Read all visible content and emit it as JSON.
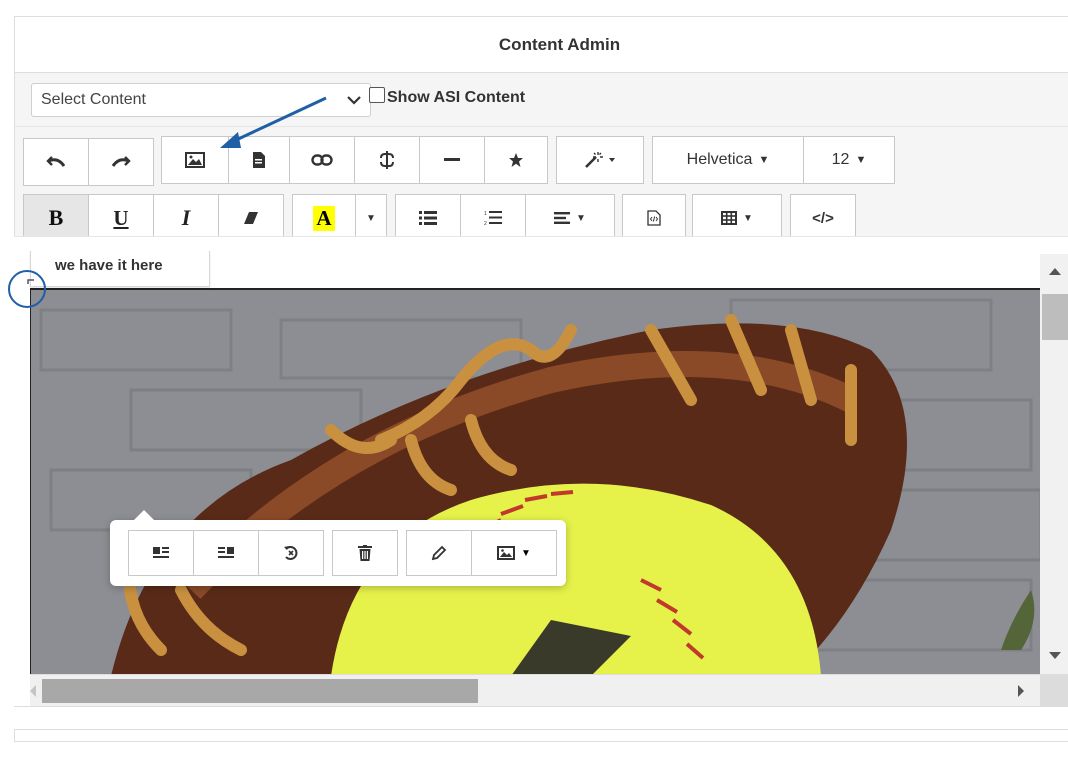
{
  "header": {
    "title": "Content Admin"
  },
  "controls": {
    "select_value": "Select Content",
    "checkbox_label": "Show ASI Content",
    "checkbox_checked": false
  },
  "toolbar": {
    "font_family": "Helvetica",
    "font_size": "12",
    "bold_label": "B",
    "underline_label": "U",
    "italic_label": "I",
    "highlight_label": "A",
    "code_view_label": "</>",
    "highlight_color": "#ffff00"
  },
  "editor": {
    "tooltip_tab_label": "we have it here"
  },
  "colors": {
    "annotation": "#1f5fa6",
    "softball": "#e6f24a",
    "glove": "#5a2a18"
  }
}
